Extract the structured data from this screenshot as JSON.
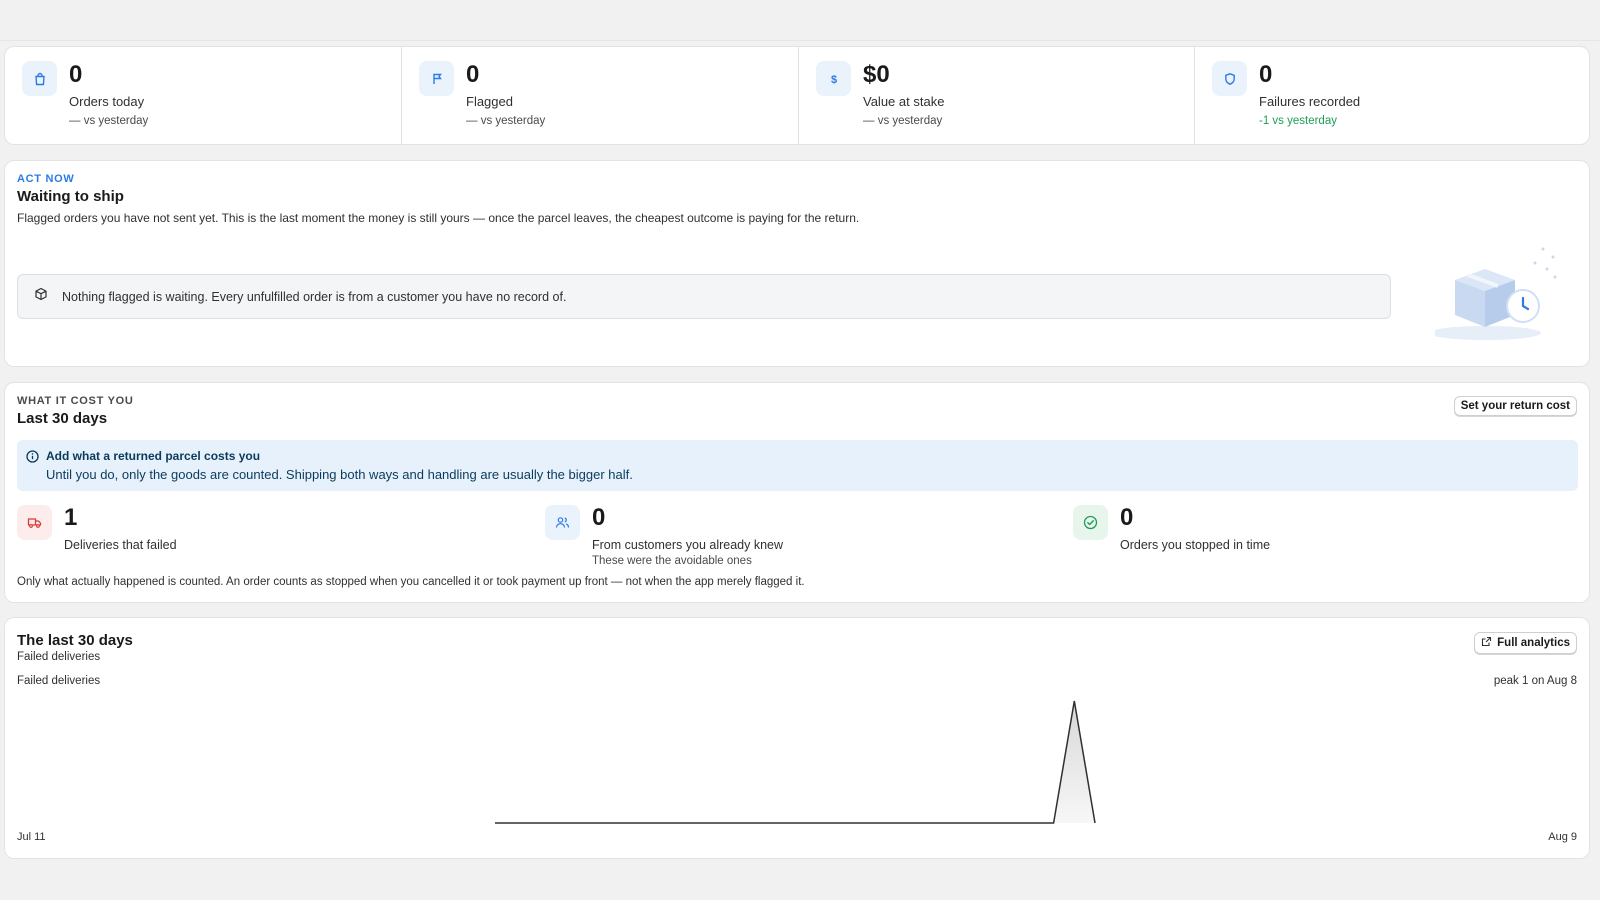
{
  "kpis": [
    {
      "icon": "shopping-bag-icon",
      "value": "0",
      "label": "Orders today",
      "delta": "— vs yesterday"
    },
    {
      "icon": "flag-icon",
      "value": "0",
      "label": "Flagged",
      "delta": "— vs yesterday"
    },
    {
      "icon": "dollar-icon",
      "value": "$0",
      "label": "Value at stake",
      "delta": "— vs yesterday"
    },
    {
      "icon": "shield-icon",
      "value": "0",
      "label": "Failures recorded",
      "delta": "-1 vs yesterday",
      "delta_color": "#1f9d55"
    }
  ],
  "act_now": {
    "eyebrow": "ACT NOW",
    "title": "Waiting to ship",
    "description": "Flagged orders you have not sent yet. This is the last moment the money is still yours — once the parcel leaves, the cheapest outcome is paying for the return.",
    "empty_icon": "package-icon",
    "empty_message": "Nothing flagged is waiting. Every unfulfilled order is from a customer you have no record of.",
    "illustration": "package-clock-illustration"
  },
  "cost": {
    "eyebrow": "WHAT IT COST YOU",
    "title": "Last 30 days",
    "button_label": "Set your return cost",
    "banner_title": "Add what a returned parcel costs you",
    "banner_body": "Until you do, only the goods are counted. Shipping both ways and handling are usually the bigger half.",
    "metrics": [
      {
        "icon": "truck-icon",
        "value": "1",
        "label": "Deliveries that failed",
        "sub": ""
      },
      {
        "icon": "users-icon",
        "value": "0",
        "label": "From customers you already knew",
        "sub": "These were the avoidable ones"
      },
      {
        "icon": "check-circle-icon",
        "value": "0",
        "label": "Orders you stopped in time",
        "sub": ""
      }
    ],
    "footnote": "Only what actually happened is counted. An order counts as stopped when you cancelled it or took payment up front — not when the app merely flagged it."
  },
  "trend": {
    "title": "The last 30 days",
    "subtitle": "Failed deliveries",
    "button_label": "Full analytics",
    "peak_label": "peak 1 on Aug 8"
  },
  "colors": {
    "accent": "#2c7be5",
    "good": "#1f9d55",
    "danger": "#d93838",
    "success_bg": "#e8f5ec"
  },
  "chart_data": {
    "type": "area",
    "series": [
      {
        "name": "Failed deliveries",
        "values": [
          0,
          0,
          0,
          0,
          0,
          0,
          0,
          0,
          0,
          0,
          0,
          0,
          0,
          0,
          0,
          0,
          0,
          0,
          0,
          0,
          0,
          0,
          0,
          0,
          0,
          0,
          0,
          0,
          1,
          0
        ]
      }
    ],
    "x": [
      "Jul 11",
      "Jul 12",
      "Jul 13",
      "Jul 14",
      "Jul 15",
      "Jul 16",
      "Jul 17",
      "Jul 18",
      "Jul 19",
      "Jul 20",
      "Jul 21",
      "Jul 22",
      "Jul 23",
      "Jul 24",
      "Jul 25",
      "Jul 26",
      "Jul 27",
      "Jul 28",
      "Jul 29",
      "Jul 30",
      "Jul 31",
      "Aug 1",
      "Aug 2",
      "Aug 3",
      "Aug 4",
      "Aug 5",
      "Aug 6",
      "Aug 7",
      "Aug 8",
      "Aug 9"
    ],
    "x_tick_labels": [
      "Jul 11",
      "Aug 9"
    ],
    "ylim": [
      0,
      1
    ],
    "grid": false,
    "legend": "none"
  }
}
